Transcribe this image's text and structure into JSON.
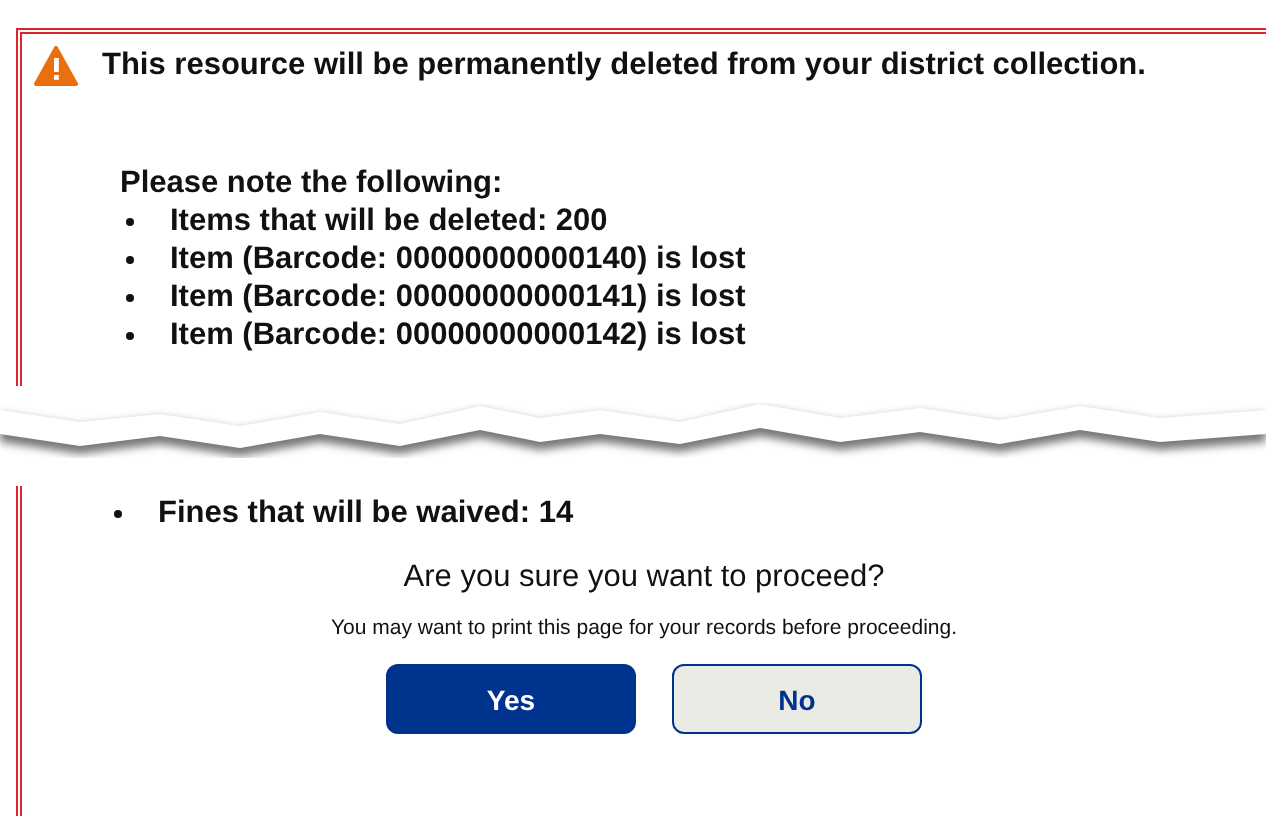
{
  "warning": {
    "message": "This resource will be permanently deleted from your district collection."
  },
  "notes": {
    "heading": "Please note the following:",
    "items": [
      "Items that will be deleted: 200",
      "Item (Barcode: 00000000000140) is lost",
      "Item (Barcode: 00000000000141) is lost",
      "Item (Barcode: 00000000000142) is lost"
    ]
  },
  "notes_continued": [
    "Fines that will be waived: 14"
  ],
  "confirm": {
    "question": "Are you sure you want to proceed?",
    "hint": "You may want to print this page for your records before proceeding."
  },
  "buttons": [
    {
      "label": "Yes",
      "kind": "primary"
    },
    {
      "label": "No",
      "kind": "secondary"
    }
  ]
}
